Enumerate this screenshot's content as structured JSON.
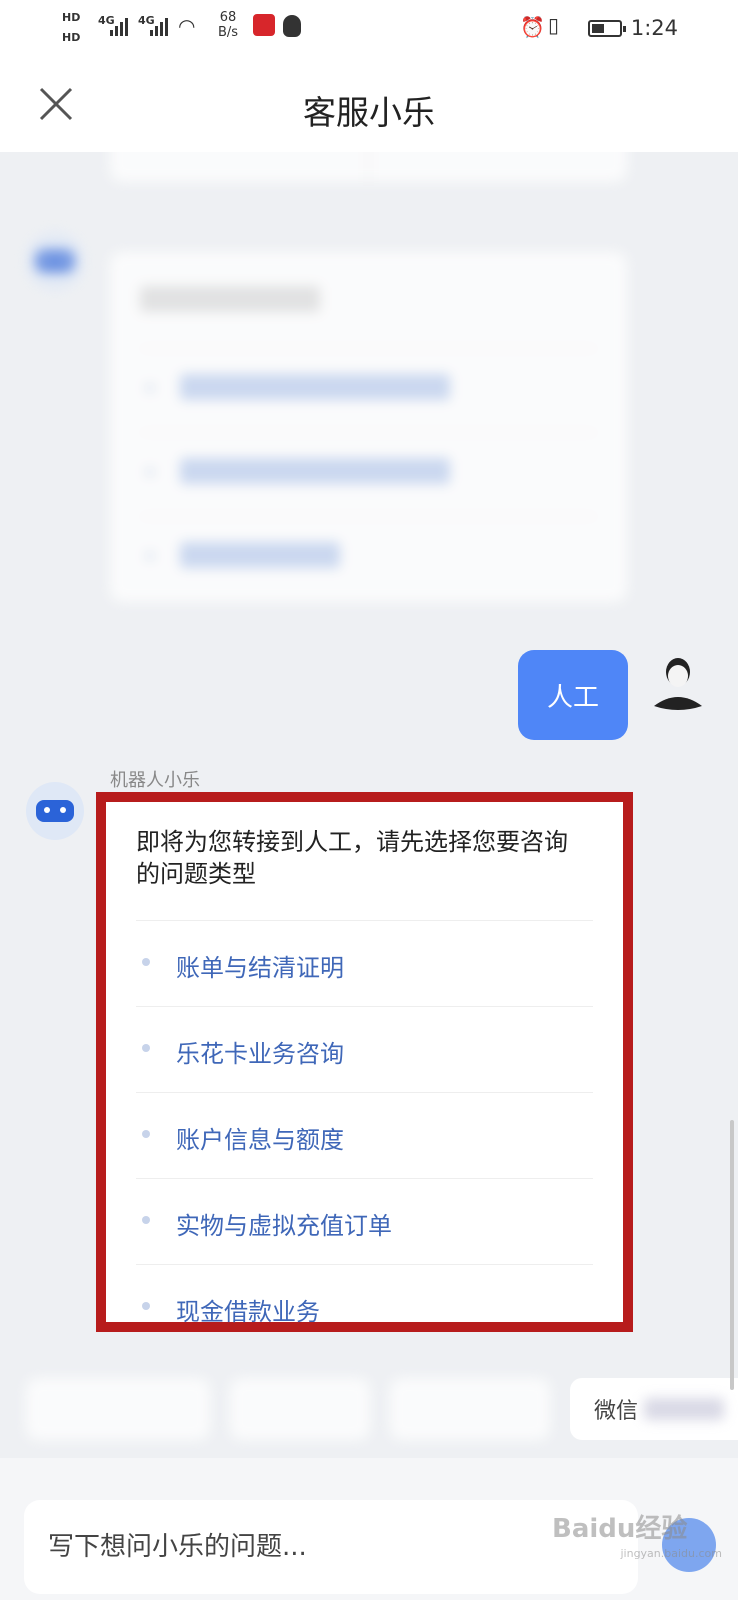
{
  "status_bar": {
    "hd1": "HD",
    "hd2": "HD",
    "net1": "4G",
    "net2": "4G",
    "speed_value": "68",
    "speed_unit": "B/s",
    "time": "1:24"
  },
  "header": {
    "title": "客服小乐"
  },
  "chat": {
    "user_message": "人工",
    "bot_name": "机器人小乐",
    "prompt": "即将为您转接到人工，请先选择您要咨询的问题类型",
    "options": [
      "账单与结清证明",
      "乐花卡业务咨询",
      "账户信息与额度",
      "实物与虚拟充值订单",
      "现金借款业务"
    ]
  },
  "quick_replies": {
    "visible_label": "微信"
  },
  "input": {
    "placeholder": "写下想问小乐的问题..."
  },
  "watermark": {
    "brand": "Baidu经验",
    "url": "jingyan.baidu.com"
  }
}
